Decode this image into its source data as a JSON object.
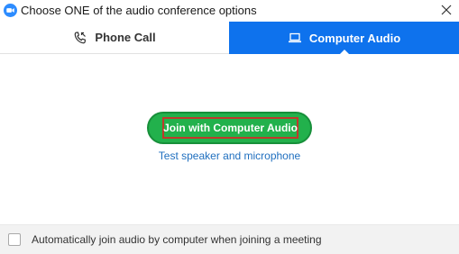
{
  "window": {
    "title": "Choose ONE of the audio conference options",
    "app_icon": "zoom-camera-icon",
    "close_icon": "close-icon"
  },
  "tabs": [
    {
      "label": "Phone Call",
      "icon": "phone-icon",
      "selected": false
    },
    {
      "label": "Computer Audio",
      "icon": "laptop-icon",
      "selected": true
    }
  ],
  "main": {
    "join_button_label": "Join with Computer Audio",
    "test_link_label": "Test speaker and microphone"
  },
  "footer": {
    "auto_join_label": "Automatically join audio by computer when joining a meeting",
    "auto_join_checked": false
  },
  "colors": {
    "accent_blue": "#0e72ed",
    "join_green": "#22b14c",
    "link_blue": "#1f6fbf",
    "highlight_red": "#c0392b"
  }
}
